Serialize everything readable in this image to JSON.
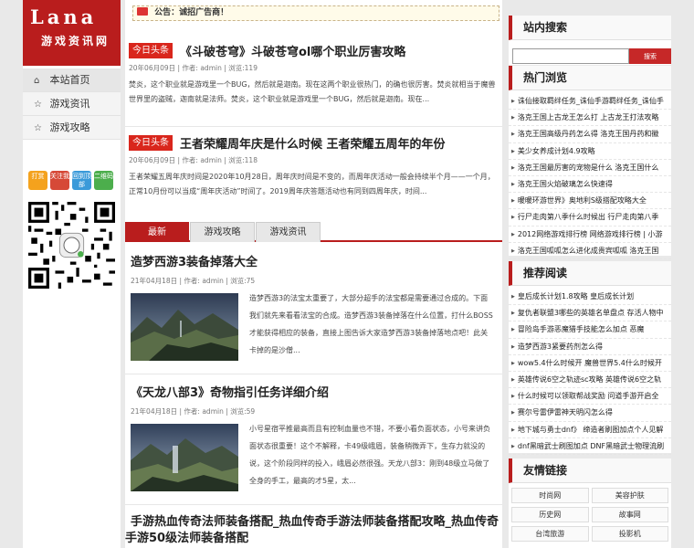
{
  "logo": {
    "line1": "Lana",
    "line2": "游戏资讯网"
  },
  "nav": {
    "items": [
      {
        "label": "本站首页",
        "icon": "home-icon"
      },
      {
        "label": "游戏资讯",
        "icon": "star-icon"
      },
      {
        "label": "游戏攻略",
        "icon": "star-icon"
      }
    ]
  },
  "buttons": [
    {
      "label": "打赏",
      "color": "#f4a21d"
    },
    {
      "label": "关注我",
      "color": "#d64937"
    },
    {
      "label": "回到顶部",
      "color": "#3a9ad9"
    },
    {
      "label": "二维码",
      "color": "#4cae4c"
    }
  ],
  "notice": {
    "text": "公告：诚招广告商！"
  },
  "top_articles": [
    {
      "tag": "今日头条",
      "title": "《斗破苍穹》斗破苍穹ol哪个职业厉害攻略",
      "meta": "20年06月09日 | 作者: admin | 浏览:119",
      "excerpt": "焚炎，这个职业就是游戏里一个BUG，然后就是迦南。现在这两个职业很热门，的确也很厉害。焚炎就相当于魔兽世界里的盗贼，迦南就是法师。焚炎，这个职业就是游戏里一个BUG，然后就是迦南。现在..."
    },
    {
      "tag": "今日头条",
      "title": "王者荣耀周年庆是什么时候 王者荣耀五周年的年份",
      "meta": "20年06月09日 | 作者: admin | 浏览:118",
      "excerpt": "王者荣耀五周年庆时间是2020年10月28日，周年庆时间是不变的，而周年庆活动一般会持续半个月——一个月，正常10月份可以当成“周年庆活动”时间了。2019周年庆答题活动也有同到四周年庆，时间..."
    }
  ],
  "tabs": [
    "最新",
    "游戏攻略",
    "游戏资讯"
  ],
  "posts": [
    {
      "title": "造梦西游3装备掉落大全",
      "meta": "21年04月18日 | 作者: admin | 浏览:75",
      "excerpt": "造梦西游3的法宝太重要了，大部分超手的法宝都是需要通过合成的。下面我们就先来看看法宝的合成。造梦西游3装备掉落在什么位置，打什么BOSS才能获得相应的装备，直接上图告诉大家造梦西游3装备掉落地点吧！此关卡掉的是沙僧..."
    },
    {
      "title": "《天龙八部3》奇物指引任务详细介绍",
      "meta": "21年04月18日 | 作者: admin | 浏览:59",
      "excerpt": "小号星宿平推最高而且有控制血量也不错，不要小看负面状态，小号来讲负面状态很重要！这个不解释，卡49级峨眉，装备稍微弄下，生存力就没的说，这个阶段同样的投入，峨眉必然很强。天龙八部3：刚到48级立马做了全身的手工，最高的才5星，太..."
    },
    {
      "title": "手游热血传奇法师装备搭配_热血传奇手游法师装备搭配攻略_热血传奇手游50级法师装备搭配"
    }
  ],
  "search": {
    "title": "站内搜索",
    "placeholder": "",
    "button": "搜索"
  },
  "hot": {
    "title": "热门浏览",
    "items": [
      "诛仙接取羁绊任务_诛仙手游羁绊任务_诛仙手",
      "洛克王国上古龙王怎么打 上古龙王打法攻略",
      "洛克王国高级丹药怎么得 洛克王国丹药和徽",
      "美少女养成计划4.9攻略",
      "洛克王国最厉害的宠物是什么 洛克王国什么",
      "洛克王国火焰破璃怎么快速得",
      "暖暖环游世界》奥地利S级搭配攻略大全",
      "行尸走肉第八季什么时候出 行尸走肉第八季",
      "2012网络游戏排行榜 网络游戏排行榜 | 小游",
      "洛克王国呱呱怎么进化成贵宾呱呱 洛克王国"
    ]
  },
  "recommend": {
    "title": "推荐阅读",
    "items": [
      "皇后成长计划1.8攻略 皇后成长计划",
      "复仇者联盟3哪些的英雄名单盘点 存活人物中",
      "冒险岛手游恶魔猎手技能怎么加点 恶魔",
      "造梦西游3紧要药剂怎么得",
      "wow5.4什么时候开 魔兽世界5.4什么时候开",
      "英雄传说6空之轨迹sc攻略 英雄传说6空之轨",
      "什么时候可以领取帮战奖励 问道手游开启全",
      "赛尔号雷伊雷神天明闪怎么得",
      "地下城与勇士dnf》 缔造者刷图加点个人见解",
      "dnf黑暗武士刷图加点 DNF黑暗武士物理流刷"
    ]
  },
  "friends": {
    "title": "友情链接",
    "items": [
      "时尚网",
      "美容护肤",
      "历史网",
      "故事网",
      "台湾旅游",
      "投影机"
    ]
  }
}
